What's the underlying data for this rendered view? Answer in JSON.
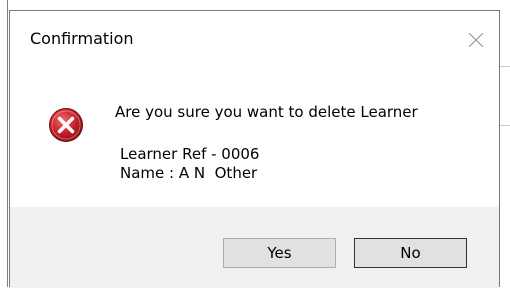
{
  "dialog": {
    "title": "Confirmation",
    "close_icon": "close-icon",
    "icon": "error-icon",
    "message": "Are you sure you want to delete Learner",
    "detail_ref": "Learner Ref - 0006",
    "detail_name": "Name : A N  Other",
    "buttons": {
      "yes_label": "Yes",
      "no_label": "No"
    }
  },
  "colors": {
    "footer_bg": "#f0f0f0",
    "error_red": "#c8202a"
  }
}
